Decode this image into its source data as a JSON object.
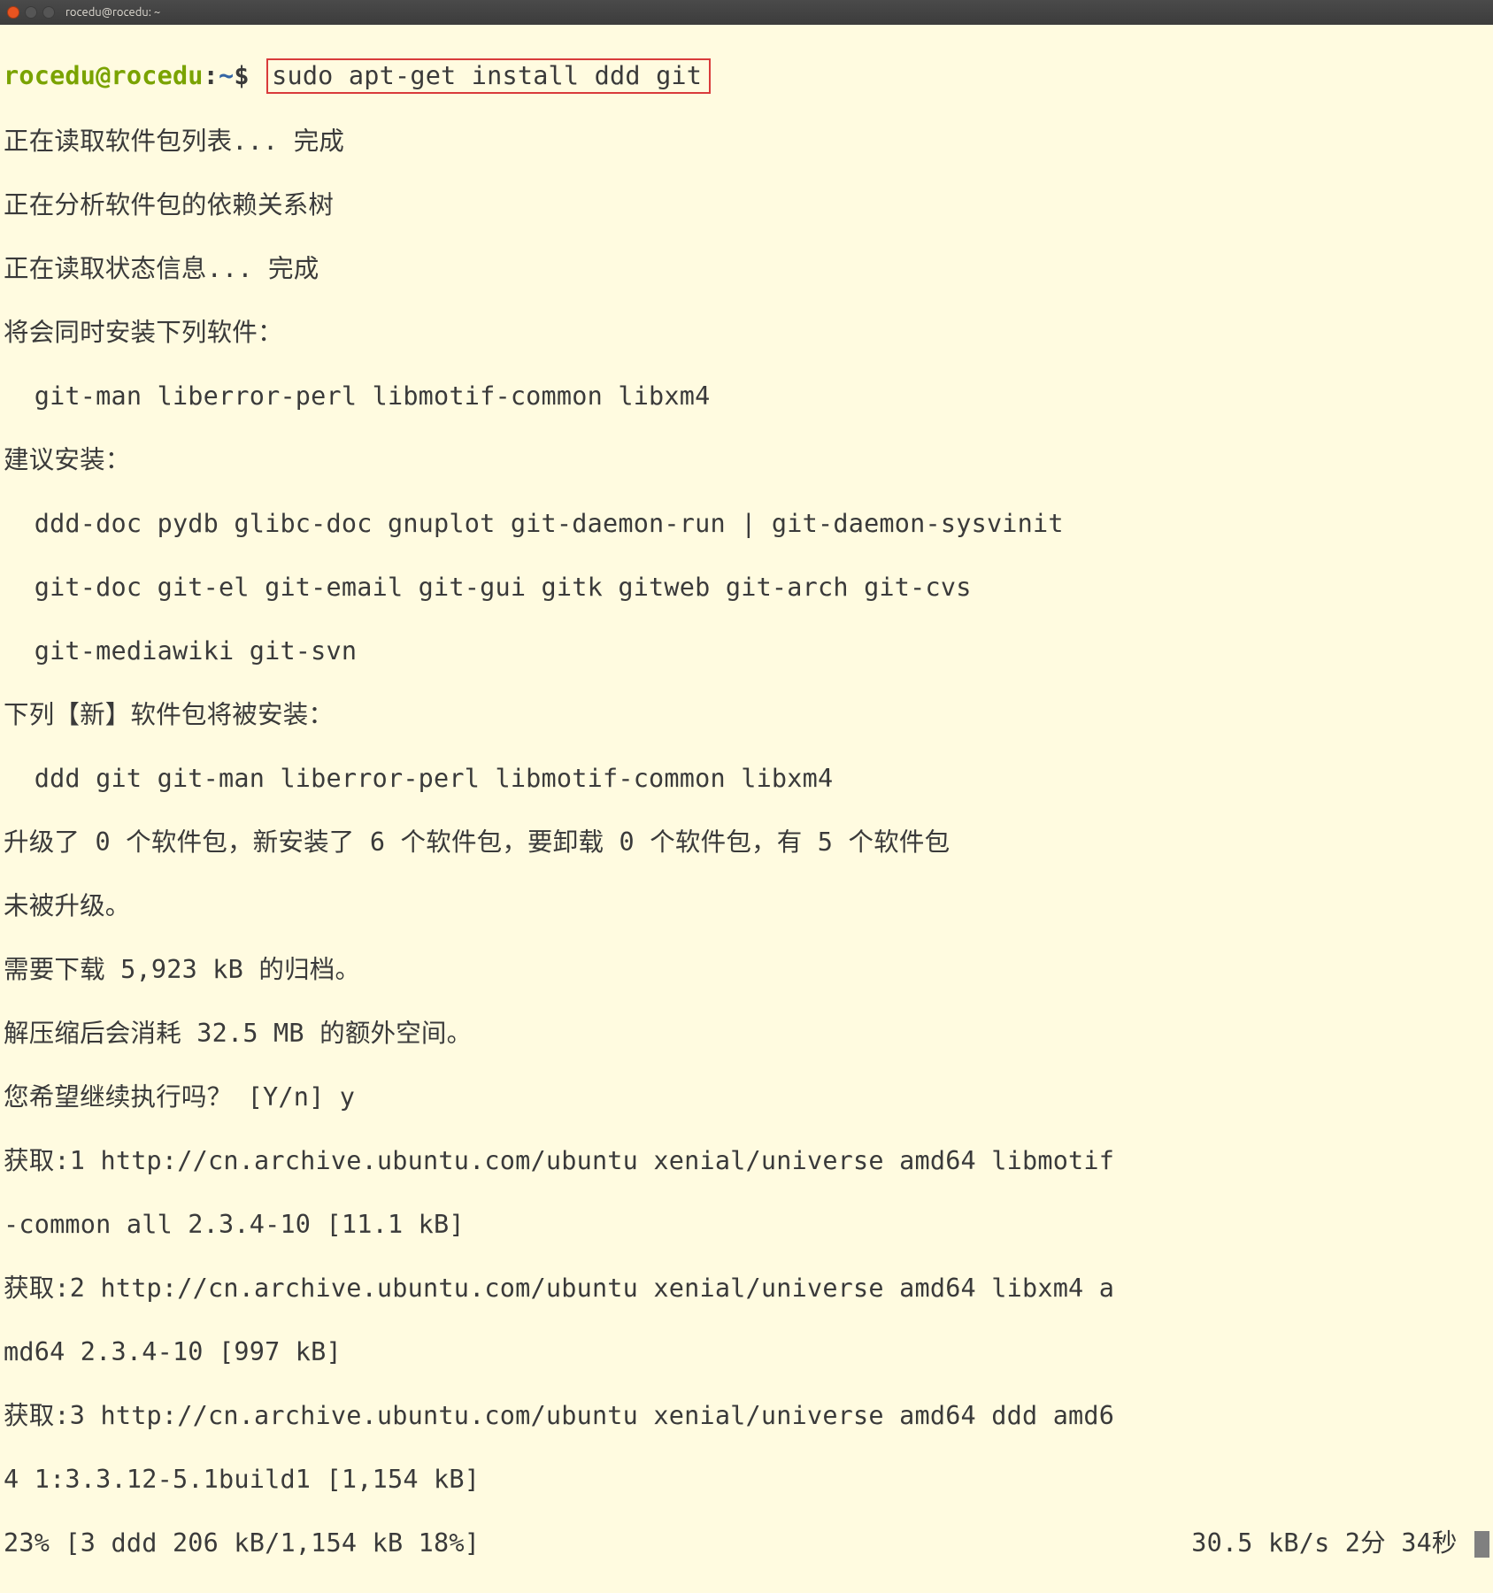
{
  "window": {
    "title": "rocedu@rocedu: ~"
  },
  "prompt": {
    "user_host": "rocedu@rocedu",
    "colon": ":",
    "path": "~",
    "dollar": "$"
  },
  "command": "sudo apt-get install ddd git",
  "lines": {
    "l1": "正在读取软件包列表... 完成",
    "l2": "正在分析软件包的依赖关系树",
    "l3": "正在读取状态信息... 完成",
    "l4": "将会同时安装下列软件：",
    "l5": "  git-man liberror-perl libmotif-common libxm4",
    "l6": "建议安装：",
    "l7": "  ddd-doc pydb glibc-doc gnuplot git-daemon-run | git-daemon-sysvinit",
    "l8": "  git-doc git-el git-email git-gui gitk gitweb git-arch git-cvs",
    "l9": "  git-mediawiki git-svn",
    "l10": "下列【新】软件包将被安装：",
    "l11": "  ddd git git-man liberror-perl libmotif-common libxm4",
    "l12": "升级了 0 个软件包，新安装了 6 个软件包，要卸载 0 个软件包，有 5 个软件包",
    "l13": "未被升级。",
    "l14": "需要下载 5,923 kB 的归档。",
    "l15": "解压缩后会消耗 32.5 MB 的额外空间。",
    "l16": "您希望继续执行吗？ [Y/n] y",
    "l17": "获取:1 http://cn.archive.ubuntu.com/ubuntu xenial/universe amd64 libmotif",
    "l18": "-common all 2.3.4-10 [11.1 kB]",
    "l19": "获取:2 http://cn.archive.ubuntu.com/ubuntu xenial/universe amd64 libxm4 a",
    "l20": "md64 2.3.4-10 [997 kB]",
    "l21": "获取:3 http://cn.archive.ubuntu.com/ubuntu xenial/universe amd64 ddd amd6",
    "l22": "4 1:3.3.12-5.1build1 [1,154 kB]"
  },
  "status": {
    "left": "23% [3 ddd 206 kB/1,154 kB 18%]",
    "right": "30.5 kB/s 2分 34秒"
  }
}
